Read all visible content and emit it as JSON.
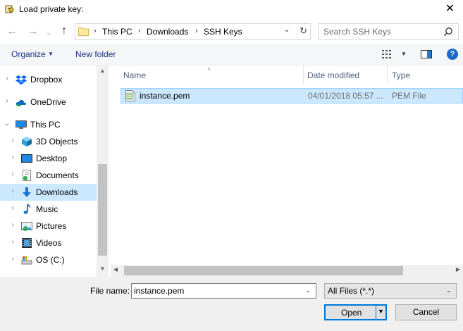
{
  "window": {
    "title": "Load private key:",
    "close_glyph": "✕",
    "icon": "key-icon"
  },
  "nav": {
    "back_glyph": "←",
    "forward_glyph": "→",
    "recent_glyph": "⌄",
    "up_glyph": "↑"
  },
  "address": {
    "crumbs": [
      "This PC",
      "Downloads",
      "SSH Keys"
    ],
    "separator": "›",
    "dropdown_glyph": "⌄",
    "refresh_glyph": "↻"
  },
  "search": {
    "placeholder": "Search SSH Keys",
    "value": ""
  },
  "toolbar": {
    "organize_label": "Organize",
    "organize_caret": "▼",
    "new_folder_label": "New folder",
    "view_caret": "▼",
    "help_glyph": "?"
  },
  "sidebar": {
    "items": [
      {
        "label": "Dropbox",
        "icon": "dropbox-icon",
        "chevron": "›",
        "level": 0
      },
      {
        "label": "OneDrive",
        "icon": "onedrive-icon",
        "chevron": "›",
        "level": 0
      },
      {
        "label": "This PC",
        "icon": "pc-icon",
        "chevron": "⌄",
        "level": 0
      },
      {
        "label": "3D Objects",
        "icon": "3d-objects-icon",
        "chevron": "›",
        "level": 1
      },
      {
        "label": "Desktop",
        "icon": "desktop-icon",
        "chevron": "›",
        "level": 1
      },
      {
        "label": "Documents",
        "icon": "documents-icon",
        "chevron": "›",
        "level": 1
      },
      {
        "label": "Downloads",
        "icon": "downloads-icon",
        "chevron": "›",
        "level": 1,
        "selected": true
      },
      {
        "label": "Music",
        "icon": "music-icon",
        "chevron": "›",
        "level": 1
      },
      {
        "label": "Pictures",
        "icon": "pictures-icon",
        "chevron": "›",
        "level": 1
      },
      {
        "label": "Videos",
        "icon": "videos-icon",
        "chevron": "›",
        "level": 1
      },
      {
        "label": "OS (C:)",
        "icon": "drive-icon",
        "chevron": "›",
        "level": 1
      }
    ],
    "scroll_up_glyph": "▲",
    "scroll_down_glyph": "▼"
  },
  "filelist": {
    "sort_glyph": "˄",
    "columns": [
      "Name",
      "Date modified",
      "Type"
    ],
    "rows": [
      {
        "name": "instance.pem",
        "date": "04/01/2018 05:57 ...",
        "type": "PEM File",
        "selected": true
      }
    ],
    "scroll_left_glyph": "◀",
    "scroll_right_glyph": "▶"
  },
  "footer": {
    "file_name_label": "File name:",
    "file_name_value": "instance.pem",
    "file_name_caret": "⌄",
    "filter_label": "All Files (*.*)",
    "filter_caret": "⌄",
    "open_label": "Open",
    "open_caret": "▼",
    "cancel_label": "Cancel"
  },
  "colors": {
    "selection": "#cce8ff",
    "selection_border": "#99d1ff",
    "accent": "#0078d7",
    "link": "#1e3287",
    "header_text": "#4c607a"
  }
}
